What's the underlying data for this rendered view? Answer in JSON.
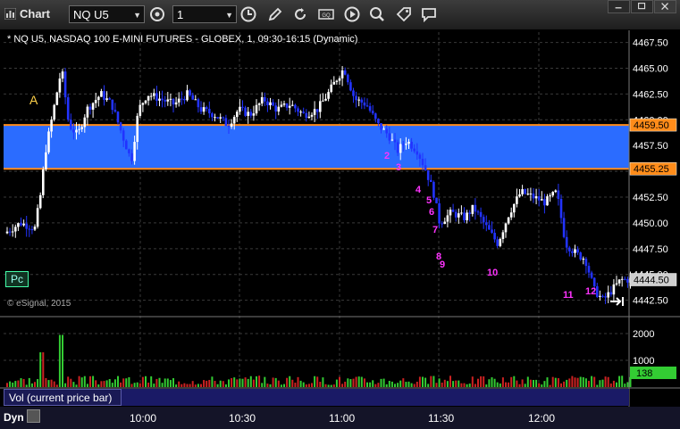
{
  "app": {
    "title": "Chart"
  },
  "toolbar": {
    "symbol": "NQ U5",
    "interval": "1",
    "tools": [
      "settings-icon",
      "clock-icon",
      "pencil-icon",
      "refresh-icon",
      "quote-icon",
      "play-icon",
      "zoom-icon",
      "tag-icon",
      "comment-icon"
    ]
  },
  "chart": {
    "header": "* NQ U5, NASDAQ 100 E-MINI FUTURES - GLOBEX, 1, 09:30-16:15 (Dynamic)",
    "watermark": "© eSignal, 2015",
    "label_a": "A",
    "pc_label": "Pc",
    "price_ticks": [
      "4467.50",
      "4465.00",
      "4462.50",
      "4460.00",
      "4457.50",
      "4455.00",
      "4452.50",
      "4450.00",
      "4447.50",
      "4445.00",
      "4442.50"
    ],
    "band": {
      "upper": "4459.50",
      "lower": "4455.25",
      "color": "#2b6cff",
      "line_color": "#ff8c1a"
    },
    "last_price": "4444.50",
    "count_labels": [
      "2",
      "3",
      "4",
      "5",
      "6",
      "7",
      "8",
      "9",
      "10",
      "11",
      "12"
    ],
    "count_color": "#ff33ff"
  },
  "volume": {
    "tab_label": "Vol (current price bar)",
    "ticks": [
      "2000",
      "1000"
    ],
    "last_value": "138"
  },
  "time_axis": {
    "labels": [
      "10:00",
      "10:30",
      "11:00",
      "11:30",
      "12:00"
    ]
  },
  "status": {
    "mode": "Dyn"
  },
  "chart_data": {
    "type": "candlestick",
    "symbol": "NQ U5",
    "interval_minutes": 1,
    "ylim": [
      4441.0,
      4468.5
    ],
    "y_ticks": [
      4467.5,
      4465.0,
      4462.5,
      4460.0,
      4457.5,
      4455.0,
      4452.5,
      4450.0,
      4447.5,
      4445.0,
      4442.5
    ],
    "x_labels": [
      "10:00",
      "10:30",
      "11:00",
      "11:30",
      "12:00"
    ],
    "anchor_points": [
      {
        "x": 0,
        "y": 4449.0
      },
      {
        "x": 18,
        "y": 4450.0
      },
      {
        "x": 34,
        "y": 4449.5
      },
      {
        "x": 40,
        "y": 4452.5
      },
      {
        "x": 46,
        "y": 4457.0
      },
      {
        "x": 55,
        "y": 4461.0
      },
      {
        "x": 64,
        "y": 4465.0
      },
      {
        "x": 72,
        "y": 4459.5
      },
      {
        "x": 82,
        "y": 4458.5
      },
      {
        "x": 92,
        "y": 4461.0
      },
      {
        "x": 108,
        "y": 4462.5
      },
      {
        "x": 120,
        "y": 4461.5
      },
      {
        "x": 130,
        "y": 4459.0
      },
      {
        "x": 142,
        "y": 4456.0
      },
      {
        "x": 150,
        "y": 4461.0
      },
      {
        "x": 160,
        "y": 4462.5
      },
      {
        "x": 175,
        "y": 4462.0
      },
      {
        "x": 190,
        "y": 4461.5
      },
      {
        "x": 205,
        "y": 4462.5
      },
      {
        "x": 220,
        "y": 4461.0
      },
      {
        "x": 235,
        "y": 4460.5
      },
      {
        "x": 250,
        "y": 4459.5
      },
      {
        "x": 262,
        "y": 4461.0
      },
      {
        "x": 275,
        "y": 4460.5
      },
      {
        "x": 290,
        "y": 4462.0
      },
      {
        "x": 305,
        "y": 4461.0
      },
      {
        "x": 320,
        "y": 4461.5
      },
      {
        "x": 335,
        "y": 4460.5
      },
      {
        "x": 350,
        "y": 4461.0
      },
      {
        "x": 362,
        "y": 4462.5
      },
      {
        "x": 372,
        "y": 4464.0
      },
      {
        "x": 380,
        "y": 4465.0
      },
      {
        "x": 392,
        "y": 4462.0
      },
      {
        "x": 405,
        "y": 4461.5
      },
      {
        "x": 418,
        "y": 4459.5
      },
      {
        "x": 430,
        "y": 4458.5
      },
      {
        "x": 440,
        "y": 4457.0
      },
      {
        "x": 450,
        "y": 4458.0
      },
      {
        "x": 462,
        "y": 4457.0
      },
      {
        "x": 472,
        "y": 4455.0
      },
      {
        "x": 480,
        "y": 4453.0
      },
      {
        "x": 487,
        "y": 4450.0
      },
      {
        "x": 500,
        "y": 4451.0
      },
      {
        "x": 515,
        "y": 4450.5
      },
      {
        "x": 525,
        "y": 4451.5
      },
      {
        "x": 540,
        "y": 4449.5
      },
      {
        "x": 552,
        "y": 4448.0
      },
      {
        "x": 565,
        "y": 4451.0
      },
      {
        "x": 578,
        "y": 4453.0
      },
      {
        "x": 592,
        "y": 4452.5
      },
      {
        "x": 605,
        "y": 4452.0
      },
      {
        "x": 618,
        "y": 4453.0
      },
      {
        "x": 628,
        "y": 4448.0
      },
      {
        "x": 640,
        "y": 4447.0
      },
      {
        "x": 650,
        "y": 4446.5
      },
      {
        "x": 660,
        "y": 4443.5
      },
      {
        "x": 670,
        "y": 4442.5
      },
      {
        "x": 680,
        "y": 4443.5
      },
      {
        "x": 690,
        "y": 4444.5
      },
      {
        "x": 702,
        "y": 4444.5
      }
    ],
    "band": {
      "upper": 4459.5,
      "lower": 4455.25
    },
    "last_price": 4444.5
  }
}
